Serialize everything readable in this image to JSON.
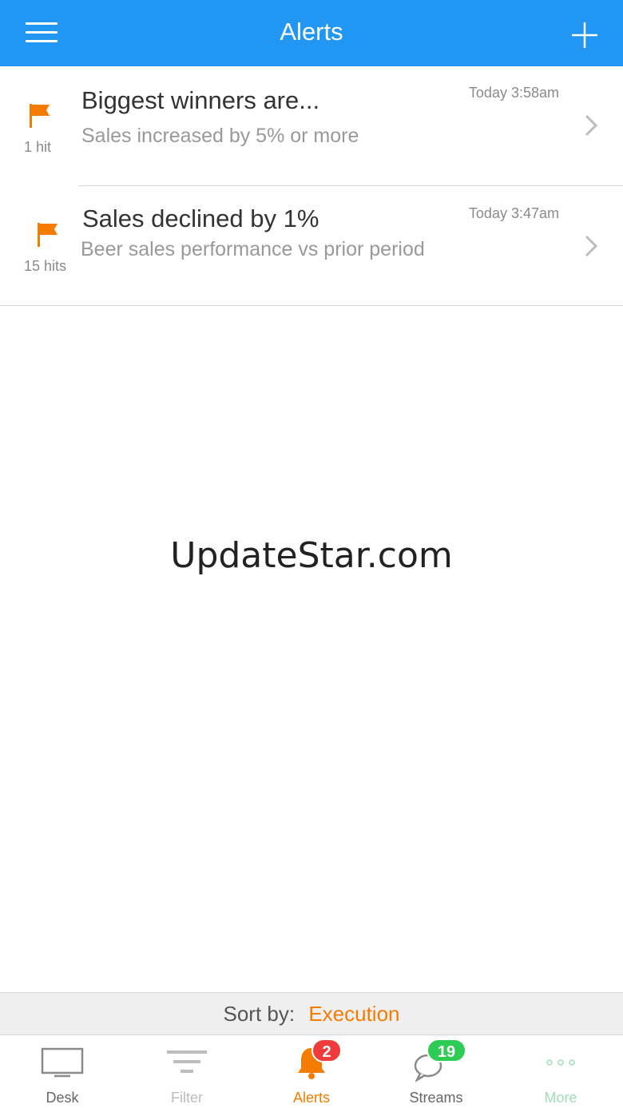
{
  "header": {
    "title": "Alerts"
  },
  "alerts": [
    {
      "title": "Biggest winners are...",
      "subtitle": "Sales increased by 5% or more",
      "hits": "1 hit",
      "time": "Today 3:58am"
    },
    {
      "title": "Sales declined by 1%",
      "subtitle": "Beer sales performance vs prior period",
      "hits": "15 hits",
      "time": "Today 3:47am"
    }
  ],
  "watermark": "UpdateStar.com",
  "sort": {
    "label": "Sort by:",
    "value": "Execution"
  },
  "tabs": [
    {
      "label": "Desk"
    },
    {
      "label": "Filter"
    },
    {
      "label": "Alerts",
      "badge": "2"
    },
    {
      "label": "Streams",
      "badge": "19"
    },
    {
      "label": "More"
    }
  ],
  "colors": {
    "header": "#2196f3",
    "accent_orange": "#f57c00",
    "badge_red": "#ef3b3b",
    "badge_green": "#2ecc55",
    "more_green": "#9fe0b5"
  },
  "icons": {
    "menu": "hamburger-icon",
    "add": "plus-icon",
    "flag": "flag-icon",
    "chevron": "chevron-right-icon",
    "desk": "monitor-icon",
    "filter": "filter-icon",
    "alerts": "bell-icon",
    "streams": "chat-bubbles-icon",
    "more": "more-dots-icon"
  }
}
